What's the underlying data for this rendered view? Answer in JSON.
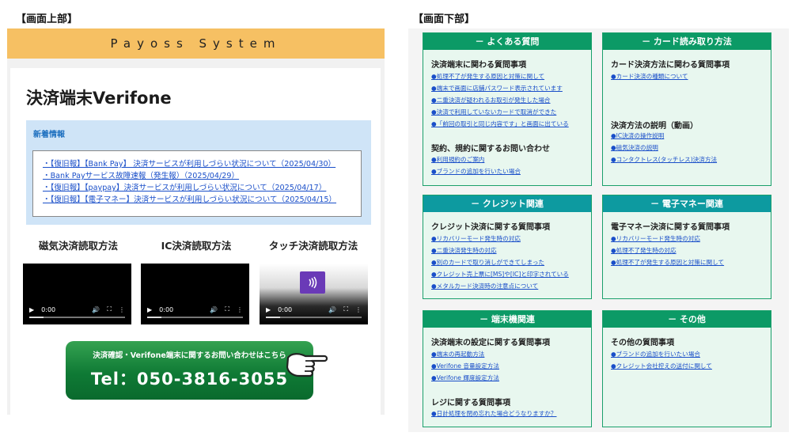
{
  "captions": {
    "top": "【画面上部】",
    "bottom": "【画面下部】"
  },
  "left": {
    "banner": "Payoss System",
    "title": "決済端末Verifone",
    "news": {
      "heading": "新着情報",
      "items": [
        "・【復旧報】【Bank Pay】 決済サービスが利用しづらい状況について（2025/04/30）",
        "・Bank Payサービス故障速報（発生報）（2025/04/29）",
        "・【復旧報】【paypay】決済サービスが利用しづらい状況について（2025/04/17）",
        "・【復旧報】【電子マネー】決済サービスが利用しづらい状況について（2025/04/15）"
      ]
    },
    "videos": [
      {
        "label": "磁気決済読取方法",
        "time": "0:00"
      },
      {
        "label": "IC決済読取方法",
        "time": "0:00"
      },
      {
        "label": "タッチ決済読取方法",
        "time": "0:00"
      }
    ],
    "contact": {
      "line1": "決済確認・Verifone端末に関するお問い合わせはこちら",
      "tel": "Tel：050-3816-3055"
    },
    "icons": {
      "play": "play-icon",
      "volume": "volume-icon",
      "fullscreen": "fullscreen-icon",
      "menu": "more-icon",
      "nfc": "contactless-icon",
      "hand": "pointing-hand-icon"
    }
  },
  "right": {
    "faq": {
      "title": "－ よくある質問",
      "sec1": "決済端末に関わる質問事項",
      "links1": [
        "●処理不了が発生する原因と対策に関して",
        "●端末で画面に店舗パスワード表示されています",
        "●二重決済が疑われるお取引が発生した場合",
        "●決済で利用していないカードで取消ができた",
        "●「前回の取引と同じ内容です」と画面に出ている"
      ],
      "sec2": "契約、規約に関するお問い合わせ",
      "links2": [
        "●利用規約のご案内",
        "●ブランドの追加を行いたい場合"
      ]
    },
    "card": {
      "title": "－ カード読み取り方法",
      "sec1": "カード決済方法に関わる質問事項",
      "links1": [
        "●カード決済の種類について"
      ],
      "sec2": "決済方法の説明（動画）",
      "links2": [
        "●IC決済の操作説明",
        "●磁気決済の説明",
        "●コンタクトレス(タッチレス)決済方法"
      ]
    },
    "credit": {
      "title": "－ クレジット関連",
      "sec1": "クレジット決済に関する質問事項",
      "links1": [
        "●リカバリーモード発生時の対応",
        "●二重決済発生時の対応",
        "●別のカードで取り消しができてしまった",
        "●クレジット売上票に[MS]や[IC]と印字されている",
        "●メタルカード決済時の注意点について"
      ]
    },
    "emoney": {
      "title": "－ 電子マネー関連",
      "sec1": "電子マネー決済に関する質問事項",
      "links1": [
        "●リカバリーモード発生時の対応",
        "●処理不了発生時の対応",
        "●処理不了が発生する原因と対策に関して"
      ]
    },
    "terminal": {
      "title": "－ 端末機関連",
      "sec1": "決済端末の設定に関する質問事項",
      "links1": [
        "●端末の再起動方法",
        "●Verifone 音量設定方法",
        "●Verifone 輝度設定方法"
      ],
      "sec2": "レジに関する質問事項",
      "links2": [
        "●日計処理を閉め忘れた場合どうなりますか？"
      ]
    },
    "other": {
      "title": "－ その他",
      "sec1": "その他の質問事項",
      "links1": [
        "●ブランドの追加を行いたい場合",
        "●クレジット会社控えの送付に関して"
      ]
    }
  }
}
